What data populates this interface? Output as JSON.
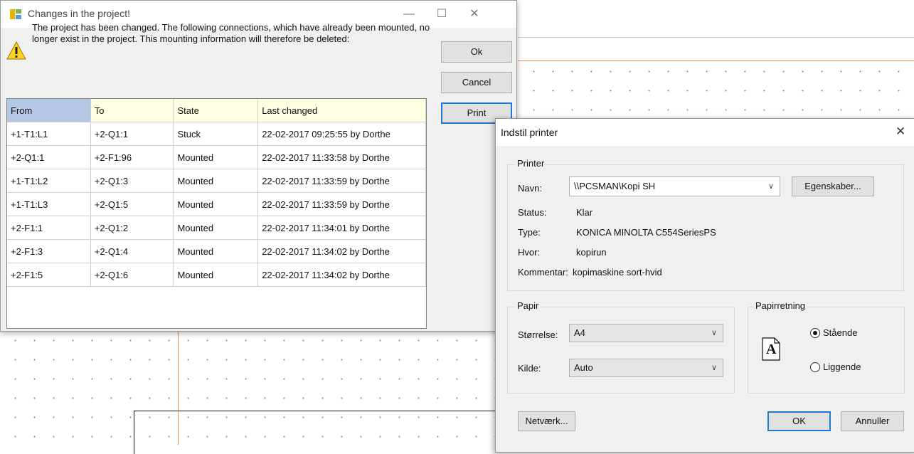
{
  "changes_dialog": {
    "title": "Changes in the project!",
    "message": "The project has been changed. The following connections, which have already been mounted, no longer exist in the project. This mounting information will therefore be deleted:",
    "buttons": {
      "ok": "Ok",
      "cancel": "Cancel",
      "print": "Print"
    },
    "window_controls": {
      "minimize": "—",
      "maximize": "☐",
      "close": "✕"
    },
    "table": {
      "columns": [
        "From",
        "To",
        "State",
        "Last changed"
      ],
      "rows": [
        [
          "+1-T1:L1",
          "+2-Q1:1",
          "Stuck",
          "22-02-2017 09:25:55 by Dorthe"
        ],
        [
          "+2-Q1:1",
          "+2-F1:96",
          "Mounted",
          "22-02-2017 11:33:58 by Dorthe"
        ],
        [
          "+1-T1:L2",
          "+2-Q1:3",
          "Mounted",
          "22-02-2017 11:33:59 by Dorthe"
        ],
        [
          "+1-T1:L3",
          "+2-Q1:5",
          "Mounted",
          "22-02-2017 11:33:59 by Dorthe"
        ],
        [
          "+2-F1:1",
          "+2-Q1:2",
          "Mounted",
          "22-02-2017 11:34:01 by Dorthe"
        ],
        [
          "+2-F1:3",
          "+2-Q1:4",
          "Mounted",
          "22-02-2017 11:34:02 by Dorthe"
        ],
        [
          "+2-F1:5",
          "+2-Q1:6",
          "Mounted",
          "22-02-2017 11:34:02 by Dorthe"
        ]
      ]
    }
  },
  "printer_dialog": {
    "title": "Indstil printer",
    "close": "✕",
    "printer_group": "Printer",
    "name_label": "Navn:",
    "name_value": "\\\\PCSMAN\\Kopi SH",
    "properties_button": "Egenskaber...",
    "status_label": "Status:",
    "status_value": "Klar",
    "type_label": "Type:",
    "type_value": "KONICA MINOLTA C554SeriesPS",
    "where_label": "Hvor:",
    "where_value": "kopirun",
    "comment_label": "Kommentar:",
    "comment_value": "kopimaskine sort-hvid",
    "paper_group": "Papir",
    "size_label": "Størrelse:",
    "size_value": "A4",
    "source_label": "Kilde:",
    "source_value": "Auto",
    "orientation_group": "Papirretning",
    "orientation_icon_letter": "A",
    "portrait_label": "Stående",
    "landscape_label": "Liggende",
    "orientation_selected": "portrait",
    "network_button": "Netværk...",
    "ok_button": "OK",
    "cancel_button": "Annuller"
  },
  "colors": {
    "focus_border": "#1e78d7",
    "header_background": "#ffffe1",
    "selected_header": "#b4c8e6",
    "canvas_line": "#e09050"
  }
}
